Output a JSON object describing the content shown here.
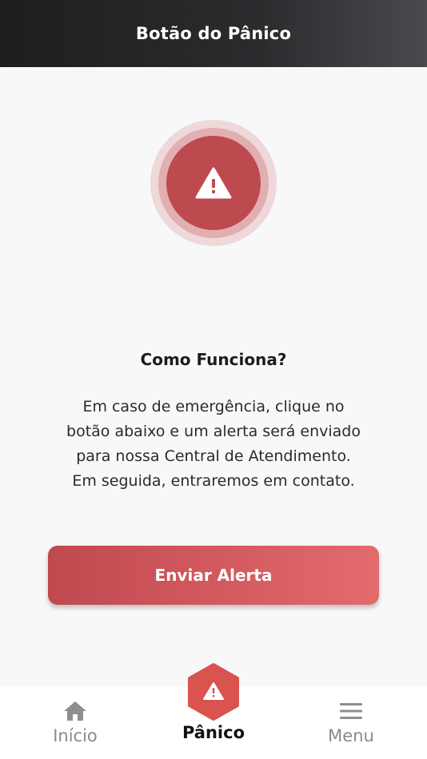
{
  "header": {
    "title": "Botão do Pânico"
  },
  "alert": {
    "icon": "warning-triangle-icon",
    "color": "#bd4a4f"
  },
  "how_it_works": {
    "title": "Como Funciona?",
    "lines": [
      "Em caso de emergência, clique no",
      "botão abaixo e um alerta será enviado",
      "para nossa Central de Atendimento.",
      "Em seguida, entraremos em contato."
    ]
  },
  "action": {
    "send_label": "Enviar Alerta",
    "color_from": "#c04950",
    "color_to": "#e36a6d"
  },
  "tabbar": {
    "home": {
      "label": "Início",
      "icon": "home-icon"
    },
    "panic": {
      "label": "Pânico",
      "icon": "warning-hexagon-icon",
      "active": true
    },
    "menu": {
      "label": "Menu",
      "icon": "hamburger-menu-icon"
    }
  }
}
